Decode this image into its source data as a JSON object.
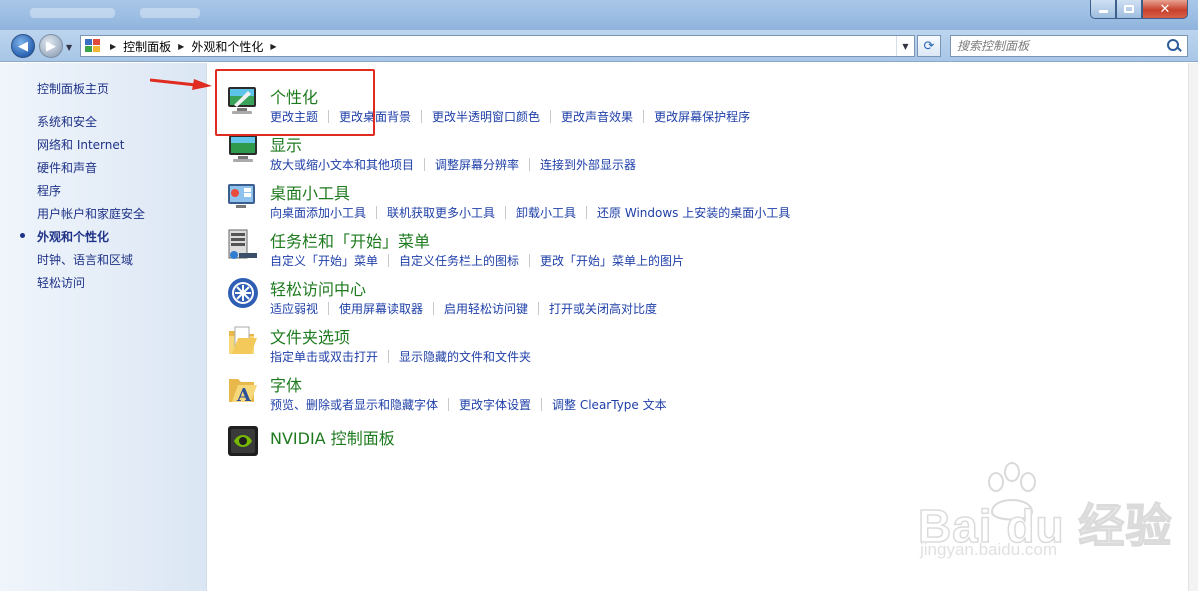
{
  "window": {
    "close_glyph": "✕"
  },
  "address_bar": {
    "crumbs": [
      "控制面板",
      "外观和个性化"
    ]
  },
  "search": {
    "placeholder": "搜索控制面板"
  },
  "left_nav": {
    "items": [
      {
        "label": "控制面板主页"
      },
      {
        "label": "系统和安全"
      },
      {
        "label": "网络和 Internet"
      },
      {
        "label": "硬件和声音"
      },
      {
        "label": "程序"
      },
      {
        "label": "用户帐户和家庭安全"
      },
      {
        "label": "外观和个性化",
        "current": true
      },
      {
        "label": "时钟、语言和区域"
      },
      {
        "label": "轻松访问"
      }
    ]
  },
  "categories": [
    {
      "title": "个性化",
      "icon": "personalization-icon",
      "links": [
        "更改主题",
        "更改桌面背景",
        "更改半透明窗口颜色",
        "更改声音效果",
        "更改屏幕保护程序"
      ]
    },
    {
      "title": "显示",
      "icon": "display-icon",
      "links": [
        "放大或缩小文本和其他项目",
        "调整屏幕分辨率",
        "连接到外部显示器"
      ]
    },
    {
      "title": "桌面小工具",
      "icon": "gadgets-icon",
      "links": [
        "向桌面添加小工具",
        "联机获取更多小工具",
        "卸载小工具",
        "还原 Windows 上安装的桌面小工具"
      ]
    },
    {
      "title": "任务栏和「开始」菜单",
      "icon": "taskbar-icon",
      "links": [
        "自定义「开始」菜单",
        "自定义任务栏上的图标",
        "更改「开始」菜单上的图片"
      ]
    },
    {
      "title": "轻松访问中心",
      "icon": "ease-of-access-icon",
      "links": [
        "适应弱视",
        "使用屏幕读取器",
        "启用轻松访问键",
        "打开或关闭高对比度"
      ]
    },
    {
      "title": "文件夹选项",
      "icon": "folder-options-icon",
      "links": [
        "指定单击或双击打开",
        "显示隐藏的文件和文件夹"
      ]
    },
    {
      "title": "字体",
      "icon": "fonts-icon",
      "links": [
        "预览、删除或者显示和隐藏字体",
        "更改字体设置",
        "调整 ClearType 文本"
      ]
    },
    {
      "title": "NVIDIA 控制面板",
      "icon": "nvidia-icon",
      "links": []
    }
  ],
  "watermark": {
    "brand": "Bai du 经验",
    "url": "jingyan.baidu.com"
  },
  "colors": {
    "category_title": "#1e7a1e",
    "link": "#1e3fa8",
    "nav_text": "#1e3287",
    "highlight_box": "#e02b20"
  }
}
